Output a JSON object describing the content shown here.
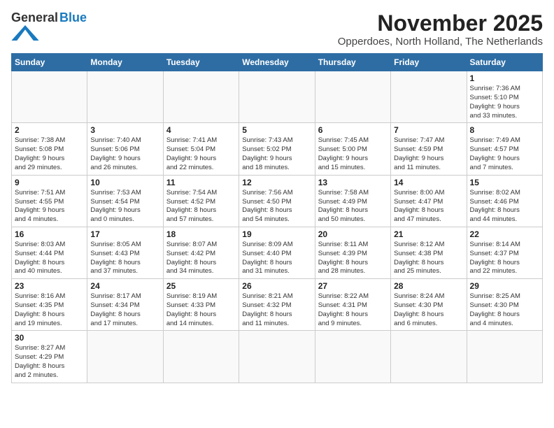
{
  "header": {
    "logo_general": "General",
    "logo_blue": "Blue",
    "month_title": "November 2025",
    "location": "Opperdoes, North Holland, The Netherlands"
  },
  "weekdays": [
    "Sunday",
    "Monday",
    "Tuesday",
    "Wednesday",
    "Thursday",
    "Friday",
    "Saturday"
  ],
  "weeks": [
    [
      {
        "day": "",
        "info": ""
      },
      {
        "day": "",
        "info": ""
      },
      {
        "day": "",
        "info": ""
      },
      {
        "day": "",
        "info": ""
      },
      {
        "day": "",
        "info": ""
      },
      {
        "day": "",
        "info": ""
      },
      {
        "day": "1",
        "info": "Sunrise: 7:36 AM\nSunset: 5:10 PM\nDaylight: 9 hours\nand 33 minutes."
      }
    ],
    [
      {
        "day": "2",
        "info": "Sunrise: 7:38 AM\nSunset: 5:08 PM\nDaylight: 9 hours\nand 29 minutes."
      },
      {
        "day": "3",
        "info": "Sunrise: 7:40 AM\nSunset: 5:06 PM\nDaylight: 9 hours\nand 26 minutes."
      },
      {
        "day": "4",
        "info": "Sunrise: 7:41 AM\nSunset: 5:04 PM\nDaylight: 9 hours\nand 22 minutes."
      },
      {
        "day": "5",
        "info": "Sunrise: 7:43 AM\nSunset: 5:02 PM\nDaylight: 9 hours\nand 18 minutes."
      },
      {
        "day": "6",
        "info": "Sunrise: 7:45 AM\nSunset: 5:00 PM\nDaylight: 9 hours\nand 15 minutes."
      },
      {
        "day": "7",
        "info": "Sunrise: 7:47 AM\nSunset: 4:59 PM\nDaylight: 9 hours\nand 11 minutes."
      },
      {
        "day": "8",
        "info": "Sunrise: 7:49 AM\nSunset: 4:57 PM\nDaylight: 9 hours\nand 7 minutes."
      }
    ],
    [
      {
        "day": "9",
        "info": "Sunrise: 7:51 AM\nSunset: 4:55 PM\nDaylight: 9 hours\nand 4 minutes."
      },
      {
        "day": "10",
        "info": "Sunrise: 7:53 AM\nSunset: 4:54 PM\nDaylight: 9 hours\nand 0 minutes."
      },
      {
        "day": "11",
        "info": "Sunrise: 7:54 AM\nSunset: 4:52 PM\nDaylight: 8 hours\nand 57 minutes."
      },
      {
        "day": "12",
        "info": "Sunrise: 7:56 AM\nSunset: 4:50 PM\nDaylight: 8 hours\nand 54 minutes."
      },
      {
        "day": "13",
        "info": "Sunrise: 7:58 AM\nSunset: 4:49 PM\nDaylight: 8 hours\nand 50 minutes."
      },
      {
        "day": "14",
        "info": "Sunrise: 8:00 AM\nSunset: 4:47 PM\nDaylight: 8 hours\nand 47 minutes."
      },
      {
        "day": "15",
        "info": "Sunrise: 8:02 AM\nSunset: 4:46 PM\nDaylight: 8 hours\nand 44 minutes."
      }
    ],
    [
      {
        "day": "16",
        "info": "Sunrise: 8:03 AM\nSunset: 4:44 PM\nDaylight: 8 hours\nand 40 minutes."
      },
      {
        "day": "17",
        "info": "Sunrise: 8:05 AM\nSunset: 4:43 PM\nDaylight: 8 hours\nand 37 minutes."
      },
      {
        "day": "18",
        "info": "Sunrise: 8:07 AM\nSunset: 4:42 PM\nDaylight: 8 hours\nand 34 minutes."
      },
      {
        "day": "19",
        "info": "Sunrise: 8:09 AM\nSunset: 4:40 PM\nDaylight: 8 hours\nand 31 minutes."
      },
      {
        "day": "20",
        "info": "Sunrise: 8:11 AM\nSunset: 4:39 PM\nDaylight: 8 hours\nand 28 minutes."
      },
      {
        "day": "21",
        "info": "Sunrise: 8:12 AM\nSunset: 4:38 PM\nDaylight: 8 hours\nand 25 minutes."
      },
      {
        "day": "22",
        "info": "Sunrise: 8:14 AM\nSunset: 4:37 PM\nDaylight: 8 hours\nand 22 minutes."
      }
    ],
    [
      {
        "day": "23",
        "info": "Sunrise: 8:16 AM\nSunset: 4:35 PM\nDaylight: 8 hours\nand 19 minutes."
      },
      {
        "day": "24",
        "info": "Sunrise: 8:17 AM\nSunset: 4:34 PM\nDaylight: 8 hours\nand 17 minutes."
      },
      {
        "day": "25",
        "info": "Sunrise: 8:19 AM\nSunset: 4:33 PM\nDaylight: 8 hours\nand 14 minutes."
      },
      {
        "day": "26",
        "info": "Sunrise: 8:21 AM\nSunset: 4:32 PM\nDaylight: 8 hours\nand 11 minutes."
      },
      {
        "day": "27",
        "info": "Sunrise: 8:22 AM\nSunset: 4:31 PM\nDaylight: 8 hours\nand 9 minutes."
      },
      {
        "day": "28",
        "info": "Sunrise: 8:24 AM\nSunset: 4:30 PM\nDaylight: 8 hours\nand 6 minutes."
      },
      {
        "day": "29",
        "info": "Sunrise: 8:25 AM\nSunset: 4:30 PM\nDaylight: 8 hours\nand 4 minutes."
      }
    ],
    [
      {
        "day": "30",
        "info": "Sunrise: 8:27 AM\nSunset: 4:29 PM\nDaylight: 8 hours\nand 2 minutes."
      },
      {
        "day": "",
        "info": ""
      },
      {
        "day": "",
        "info": ""
      },
      {
        "day": "",
        "info": ""
      },
      {
        "day": "",
        "info": ""
      },
      {
        "day": "",
        "info": ""
      },
      {
        "day": "",
        "info": ""
      }
    ]
  ]
}
